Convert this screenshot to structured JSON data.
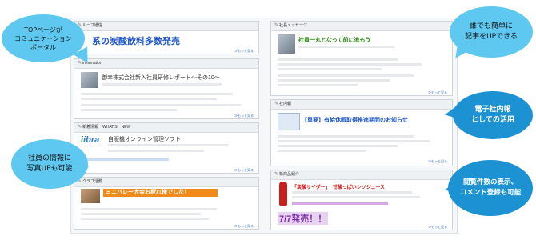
{
  "cards": {
    "top_left": {
      "header": "ループ通信",
      "title": "系の炭酸飲料多数発売",
      "more": "≫もっと見る"
    },
    "information": {
      "header": "information",
      "title": "御幸株式会社新入社員研修レポート～その10～",
      "more": "≫もっと見る"
    },
    "whats_new": {
      "header": "新着情報　WHAT'S　NEW",
      "title": "自販機オンライン管理ソフト",
      "logo": "ibra",
      "logo_prefix": "i",
      "more": "≫もっと見る"
    },
    "club": {
      "header": "クラブ活動",
      "title": "ミニバレー大会お疲れ様でした！",
      "more": "≫もっと見る"
    },
    "president": {
      "header": "社長メッセージ",
      "title": "社員一丸となって前に進もう",
      "more": "≫もっと見る"
    },
    "notice": {
      "header": "社内報",
      "title": "【重要】有給休暇取得推進期間のお知らせ",
      "more": "≫もっと見る"
    },
    "product": {
      "header": "新商品紹介",
      "title": "「炭酸サイダー」　甘酸っぱいシソジュース",
      "price": "7/7発売！！",
      "more": "≫もっと見る"
    }
  },
  "bubbles": {
    "top_left": "TOPページが\nコミュニケーション\nポータル",
    "top_right": "誰でも簡単に\n記事をUPできる",
    "mid_left": "社員の情報に\n写真UPも可能",
    "mid_right": "電子社内報\nとしての活用",
    "bottom_right": "閲覧件数の表示、\nコメント登録も可能"
  },
  "colors": {
    "blue_title": "#1e55c8",
    "green_title": "#2b8a13",
    "orange_banner": "#f08a1a",
    "red_title": "#d11414",
    "bubble_light": "#5ec8f0",
    "bubble_dark": "#1c92d2"
  }
}
